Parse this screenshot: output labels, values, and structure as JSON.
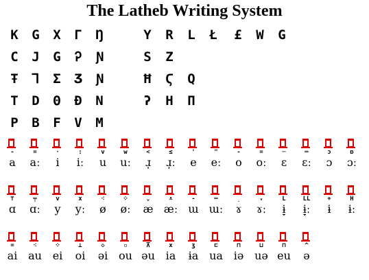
{
  "title": "The Latheb Writing System",
  "consonants": {
    "left": [
      [
        "K",
        "G",
        "X",
        "Γ",
        "Ŋ"
      ],
      [
        "C",
        "J",
        "G",
        "Ꭾ",
        "Ɲ"
      ],
      [
        "Ŧ",
        "Ꞁ",
        "Σ",
        "Ʒ",
        "Ɲ"
      ],
      [
        "T",
        "D",
        "Θ",
        "Đ",
        "N"
      ],
      [
        "P",
        "B",
        "F",
        "V",
        "M"
      ]
    ],
    "right": [
      [
        "Y",
        "R",
        "L",
        "Ł",
        "£",
        "W",
        "G"
      ],
      [
        "S",
        "Z"
      ],
      [
        "Ħ",
        "Ϛ",
        "Q"
      ],
      [
        "ʔ",
        "H",
        "Π"
      ]
    ]
  },
  "vowels": {
    "row1": [
      {
        "mark": "-",
        "ipa": "a"
      },
      {
        "mark": "=",
        "ipa": "aː"
      },
      {
        "mark": "·",
        "ipa": "i"
      },
      {
        "mark": ":",
        "ipa": "iː"
      },
      {
        "mark": "v",
        "ipa": "u"
      },
      {
        "mark": "w",
        "ipa": "uː"
      },
      {
        "mark": "<",
        "ipa": "ɹ̩"
      },
      {
        "mark": "≤",
        "ipa": "ɹ̩ː"
      },
      {
        "mark": "'",
        "ipa": "e"
      },
      {
        "mark": "\"",
        "ipa": "eː"
      },
      {
        "mark": "-",
        "ipa": "o"
      },
      {
        "mark": "=",
        "ipa": "oː"
      },
      {
        "mark": "─",
        "ipa": "ɛ"
      },
      {
        "mark": "═",
        "ipa": "ɛː"
      },
      {
        "mark": "ɔ",
        "ipa": "ɔ"
      },
      {
        "mark": "ɒ",
        "ipa": "ɔː"
      }
    ],
    "row2": [
      {
        "mark": "⊤",
        "ipa": "ɑ"
      },
      {
        "mark": "╤",
        "ipa": "ɑː"
      },
      {
        "mark": "v",
        "ipa": "y"
      },
      {
        "mark": "x",
        "ipa": "yː"
      },
      {
        "mark": "⁖",
        "ipa": "ø"
      },
      {
        "mark": "⁘",
        "ipa": "øː"
      },
      {
        "mark": "⌄",
        "ipa": "æ"
      },
      {
        "mark": "⩡",
        "ipa": "æː"
      },
      {
        "mark": "-",
        "ipa": "ɯ"
      },
      {
        "mark": "═",
        "ipa": "ɯː"
      },
      {
        "mark": "˯",
        "ipa": "ɤ"
      },
      {
        "mark": "ᵥ",
        "ipa": "ɤː"
      },
      {
        "mark": "L",
        "ipa": "ɨ̞"
      },
      {
        "mark": "LL",
        "ipa": "ɨ̞ː"
      },
      {
        "mark": "+",
        "ipa": "ɨ"
      },
      {
        "mark": "H",
        "ipa": "ɨː"
      }
    ],
    "row3": [
      {
        "mark": "=",
        "ipa": "ai"
      },
      {
        "mark": "⁖",
        "ipa": "au"
      },
      {
        "mark": "⁘",
        "ipa": "ei"
      },
      {
        "mark": "⊥",
        "ipa": "oi"
      },
      {
        "mark": "◇",
        "ipa": "əi"
      },
      {
        "mark": "▫",
        "ipa": "ou"
      },
      {
        "mark": "⊼",
        "ipa": "əu"
      },
      {
        "mark": "x",
        "ipa": "ia"
      },
      {
        "mark": "ʒ",
        "ipa": "ɨa"
      },
      {
        "mark": "⊏",
        "ipa": "ua"
      },
      {
        "mark": "⊓",
        "ipa": "iə"
      },
      {
        "mark": "⊔",
        "ipa": "uə"
      },
      {
        "mark": "⊓",
        "ipa": "eu"
      },
      {
        "mark": "^",
        "ipa": "ə"
      }
    ]
  }
}
